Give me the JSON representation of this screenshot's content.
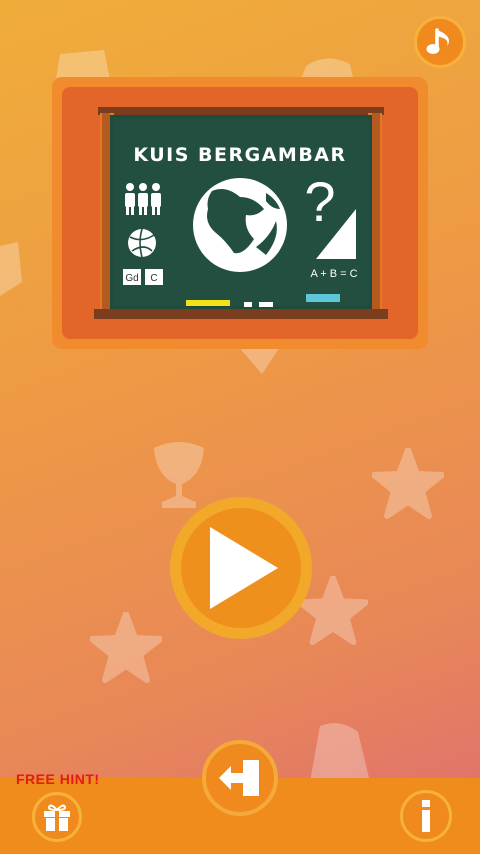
{
  "game": {
    "title": "KUIS BERGAMBAR",
    "formula": "A + B = C",
    "letter_cards": [
      "Gd",
      "C"
    ],
    "question_mark": "?"
  },
  "bottom": {
    "free_hint_label": "FREE HINT!"
  },
  "colors": {
    "background_top": "#f0ad3a",
    "background_bottom": "#de6d72",
    "button_fill": "#f08a1e",
    "button_ring": "#f7b23b",
    "board_green": "#1f4a3c",
    "hint_red": "#e61919"
  },
  "icons": {
    "music": "music-note-icon",
    "play": "play-icon",
    "exit": "exit-icon",
    "gift": "gift-icon",
    "info": "info-icon"
  }
}
